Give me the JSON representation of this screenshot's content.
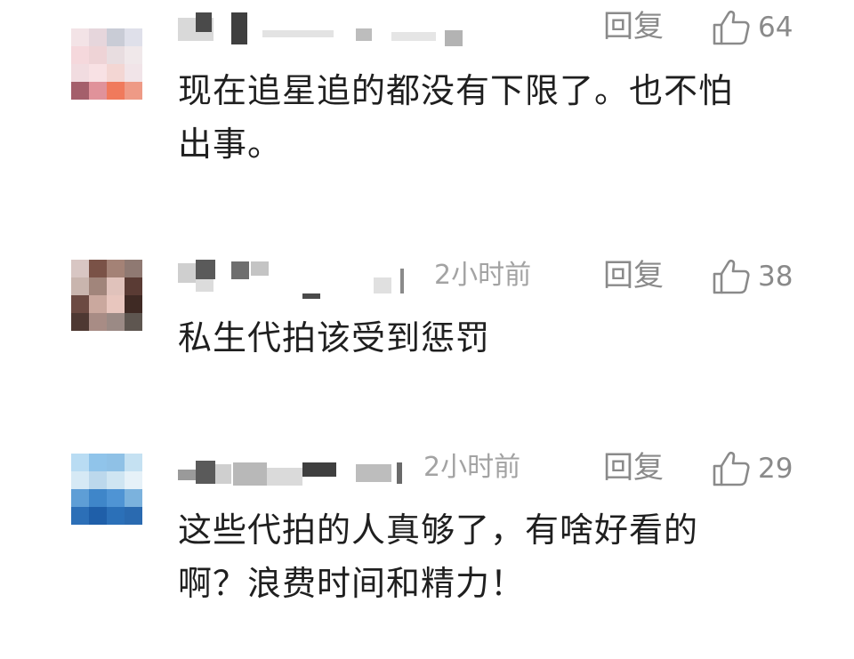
{
  "comments": [
    {
      "time": "",
      "reply_label": "回复",
      "like_count": "64",
      "text_line1": "现在追星追的都没有下限了。也不怕",
      "text_line2": "出事。",
      "avatar_colors": [
        "#f3e3e6",
        "#e6d6dc",
        "#c9ccd6",
        "#dfe0ea",
        "#f5d8dc",
        "#eed3d6",
        "#e8dde0",
        "#f0e8ea",
        "#f1dce0",
        "#f8e1e4",
        "#f3d6d3",
        "#f1e4e8",
        "#a45f6b",
        "#e0929a",
        "#f07a5c",
        "#ee9a86"
      ]
    },
    {
      "time": "2小时前",
      "reply_label": "回复",
      "like_count": "38",
      "text_line1": "私生代拍该受到惩罚",
      "text_line2": "",
      "avatar_colors": [
        "#d8c6c3",
        "#7a5247",
        "#a48276",
        "#8f7972",
        "#c9b5ae",
        "#a1857b",
        "#e0c2bb",
        "#5a3b34",
        "#6c4a42",
        "#caa89e",
        "#e8c6be",
        "#3f2a24",
        "#4e3832",
        "#a88c85",
        "#9b8a85",
        "#5e5650"
      ]
    },
    {
      "time": "2小时前",
      "reply_label": "回复",
      "like_count": "29",
      "text_line1": "这些代拍的人真够了，有啥好看的",
      "text_line2": "啊？浪费时间和精力！",
      "avatar_colors": [
        "#b9dcf3",
        "#90c4ea",
        "#8fc1e6",
        "#c5e1f2",
        "#d6e9f5",
        "#bcd8ec",
        "#cfe5f2",
        "#e6f1f8",
        "#5e9ed6",
        "#3f86c9",
        "#4f94d4",
        "#7bb2dd",
        "#2c6fb7",
        "#1f5fa9",
        "#2b70b8",
        "#2a6ab0"
      ]
    }
  ]
}
